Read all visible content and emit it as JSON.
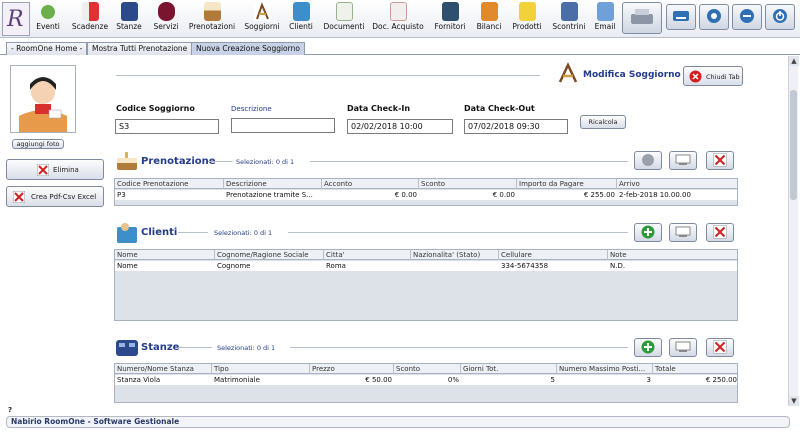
{
  "toolbar": {
    "items": [
      {
        "label": "Eventi",
        "icon": "bell-icon"
      },
      {
        "label": "Scadenze",
        "icon": "flag-icon"
      },
      {
        "label": "Stanze",
        "icon": "bed-icon"
      },
      {
        "label": "Servizi",
        "icon": "bag-icon"
      },
      {
        "label": "Prenotazioni",
        "icon": "cake-icon"
      },
      {
        "label": "Soggiorni",
        "icon": "stay-icon"
      },
      {
        "label": "Clienti",
        "icon": "clients-icon"
      },
      {
        "label": "Documenti",
        "icon": "documents-icon"
      },
      {
        "label": "Doc. Acquisto",
        "icon": "purchase-doc-icon"
      },
      {
        "label": "Fornitori",
        "icon": "suppliers-icon"
      },
      {
        "label": "Bilanci",
        "icon": "balance-icon"
      },
      {
        "label": "Prodotti",
        "icon": "products-icon"
      },
      {
        "label": "Scontrini",
        "icon": "receipt-icon"
      },
      {
        "label": "Email",
        "icon": "email-icon"
      }
    ]
  },
  "tabs": [
    {
      "label": "- RoomOne Home -"
    },
    {
      "label": "Mostra Tutti Prenotazione"
    },
    {
      "label": "Nuova Creazione Soggiorno"
    }
  ],
  "sidebar": {
    "photo_button": "aggiungi foto",
    "delete_button": "Elimina",
    "export_button": "Crea Pdf-Csv Excel"
  },
  "header": {
    "title": "Modifica Soggiorno",
    "close_button": "Chiudi Tab"
  },
  "form": {
    "code_label": "Codice Soggiorno",
    "code_value": "S3",
    "description_label": "Descrizione",
    "description_value": "",
    "checkin_label": "Data Check-In",
    "checkin_value": "02/02/2018 10:00",
    "checkout_label": "Data Check-Out",
    "checkout_value": "07/02/2018 09:30",
    "recalc_button": "Ricalcola"
  },
  "prenotazione": {
    "title": "Prenotazione",
    "selected": "Selezionati:  0 di 1",
    "columns": [
      "Codice Prenotazione",
      "Descrizione",
      "Acconto",
      "Sconto",
      "Importo da Pagare",
      "Arrivo"
    ],
    "rows": [
      [
        "P3",
        "Prenotazione tramite S...",
        "€ 0.00",
        "€ 0.00",
        "€ 255.00",
        "2-feb-2018 10.00.00"
      ]
    ]
  },
  "clienti": {
    "title": "Clienti",
    "selected": "Selezionati:  0 di 1",
    "columns": [
      "Nome",
      "Cognome/Ragione Sociale",
      "Citta'",
      "Nazionalita' (Stato)",
      "Cellulare",
      "Note"
    ],
    "rows": [
      [
        "Nome",
        "Cognome",
        "Roma",
        "",
        "334-5674358",
        "N.D."
      ]
    ]
  },
  "stanze": {
    "title": "Stanze",
    "selected": "Selezionati:  0 di 1",
    "columns": [
      "Numero/Nome Stanza",
      "Tipo",
      "Prezzo",
      "Sconto",
      "Giorni Tot.",
      "Numero Massimo Posti...",
      "Totale"
    ],
    "rows": [
      [
        "Stanza Viola",
        "Matrimoniale",
        "€ 50.00",
        "0%",
        "5",
        "3",
        "€ 250.00"
      ]
    ]
  },
  "status_bar": "Nabirio RoomOne - Software Gestionale",
  "help_mark": "?"
}
